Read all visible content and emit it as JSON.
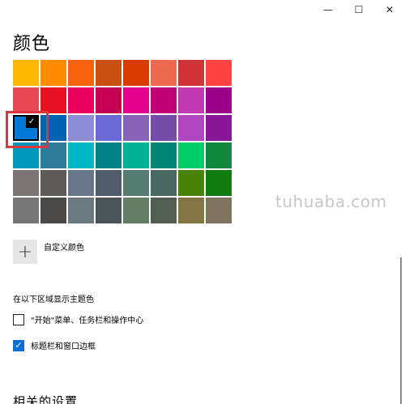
{
  "window": {
    "minimize_glyph": "—",
    "maximize_glyph": "☐",
    "close_glyph": "✕"
  },
  "title": "颜色",
  "swatches": [
    [
      "#ffb900",
      "#ff8c00",
      "#f7630c",
      "#ca5010",
      "#da3b01",
      "#ef6950",
      "#d13438",
      "#ff4343"
    ],
    [
      "#e74856",
      "#e81123",
      "#ea005e",
      "#c30052",
      "#e3008c",
      "#bf0077",
      "#c239b3",
      "#9a0089"
    ],
    [
      "#0078d7",
      "#0063b1",
      "#8e8cd8",
      "#6b69d6",
      "#8764b8",
      "#744da9",
      "#b146c2",
      "#881798"
    ],
    [
      "#0099bc",
      "#2d7d9a",
      "#00b7c3",
      "#038387",
      "#00b294",
      "#018574",
      "#00cc6a",
      "#10893e"
    ],
    [
      "#7a7574",
      "#5d5a58",
      "#68768a",
      "#515c6b",
      "#567c73",
      "#486860",
      "#498205",
      "#107c10"
    ],
    [
      "#767676",
      "#4c4a48",
      "#69797e",
      "#4a5459",
      "#647c64",
      "#525e54",
      "#847545",
      "#7e735f"
    ]
  ],
  "selected_swatch": {
    "row": 2,
    "col": 0
  },
  "check_glyph": "✓",
  "watermark": "tuhuaba.com",
  "custom_color": {
    "plus_glyph": "+",
    "label": "自定义颜色"
  },
  "accent_section": {
    "label": "在以下区域显示主题色",
    "options": [
      {
        "label": "\"开始\"菜单、任务栏和操作中心",
        "checked": false
      },
      {
        "label": "标题栏和窗口边框",
        "checked": true
      }
    ]
  },
  "related_settings": "相关的设置",
  "colors": {
    "accent": "#0a6fd6",
    "highlight_box": "#d9363e"
  }
}
